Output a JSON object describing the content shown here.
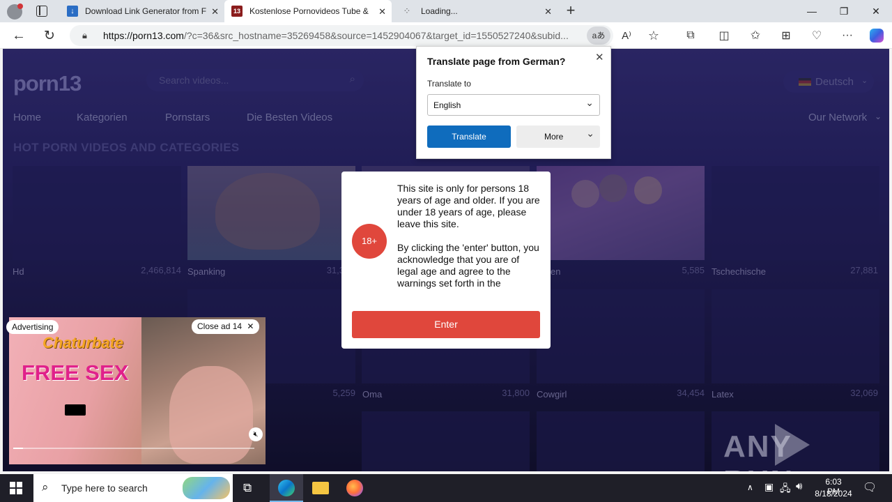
{
  "browser": {
    "tabs": [
      {
        "title": "Download Link Generator from F",
        "icon": "download-icon"
      },
      {
        "title": "Kostenlose Pornovideos Tube & ",
        "icon": "site-13-icon"
      },
      {
        "title": "Loading...",
        "icon": "loading-icon"
      }
    ],
    "new_tab": "+",
    "address": {
      "host": "https://porn13.com",
      "rest": "/?c=36&src_hostname=35269458&source=1452904067&target_id=1550527240&subid..."
    }
  },
  "site": {
    "logo": "porn13",
    "search_placeholder": "Search videos...",
    "language": "Deutsch",
    "nav": [
      "Home",
      "Kategorien",
      "Pornstars",
      "Die Besten Videos"
    ],
    "network": "Our Network",
    "section_title": "HOT PORN VIDEOS AND CATEGORIES",
    "categories_row1": [
      {
        "name": "Hd",
        "count": "2,466,814"
      },
      {
        "name": "Spanking",
        "count": "31,3"
      },
      {
        "name": "",
        "count": ""
      },
      {
        "name": "en",
        "count": "5,585"
      },
      {
        "name": "Tschechische",
        "count": "27,881"
      }
    ],
    "categories_row2": [
      {
        "name": "",
        "count": "5,259"
      },
      {
        "name": "Oma",
        "count": "31,800"
      },
      {
        "name": "Cowgirl",
        "count": "34,454"
      },
      {
        "name": "Latex",
        "count": "32,069"
      }
    ]
  },
  "translate_popup": {
    "title": "Translate page from German?",
    "to_label": "Translate to",
    "language": "English",
    "translate_btn": "Translate",
    "more_btn": "More"
  },
  "age_gate": {
    "badge": "18+",
    "text1": "This site is only for persons 18 years of age and older. If you are under 18 years of age, please leave this site.",
    "text2": "By clicking the 'enter' button, you acknowledge that you are of legal age and agree to the warnings set forth in the",
    "enter_btn": "Enter"
  },
  "ad": {
    "advertising": "Advertising",
    "close": "Close ad 14",
    "brand": "Chaturbate",
    "headline": "FREE SEX"
  },
  "watermark": "ANY RUN",
  "taskbar": {
    "search": "Type here to search",
    "time": "6:03 PM",
    "date": "8/18/2024"
  },
  "colors": {
    "accent_blue": "#0f6cbd",
    "age_red": "#e0473c",
    "page_bg": "#2d2870"
  }
}
